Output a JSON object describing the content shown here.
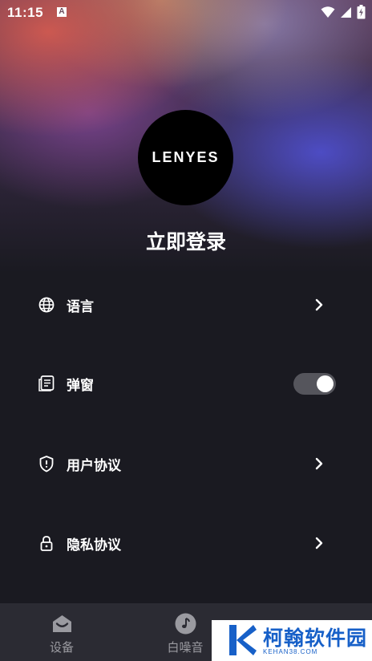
{
  "status_bar": {
    "time": "11:15",
    "notification_glyph": "A",
    "icons": [
      "wifi-icon",
      "signal-icon",
      "battery-icon"
    ]
  },
  "profile": {
    "logo_text": "LENYES",
    "login_label": "立即登录"
  },
  "menu": [
    {
      "id": "language",
      "label": "语言",
      "icon": "globe-icon",
      "control": "chevron"
    },
    {
      "id": "popup",
      "label": "弹窗",
      "icon": "document-icon",
      "control": "toggle",
      "toggle_on": true
    },
    {
      "id": "user-agreement",
      "label": "用户协议",
      "icon": "shield-icon",
      "control": "chevron"
    },
    {
      "id": "privacy-agreement",
      "label": "隐私协议",
      "icon": "lock-icon",
      "control": "chevron"
    }
  ],
  "tabbar": {
    "tabs": [
      {
        "label": "设备",
        "icon": "device-icon"
      },
      {
        "label": "白噪音",
        "icon": "music-note-icon"
      }
    ]
  },
  "watermark": {
    "title": "柯翰软件园",
    "subtitle": "KEHAN38.COM"
  },
  "colors": {
    "background": "#1a1a21",
    "tabbar": "#2b2b33",
    "toggle_track": "#55555c",
    "watermark_blue": "#1760c8"
  }
}
